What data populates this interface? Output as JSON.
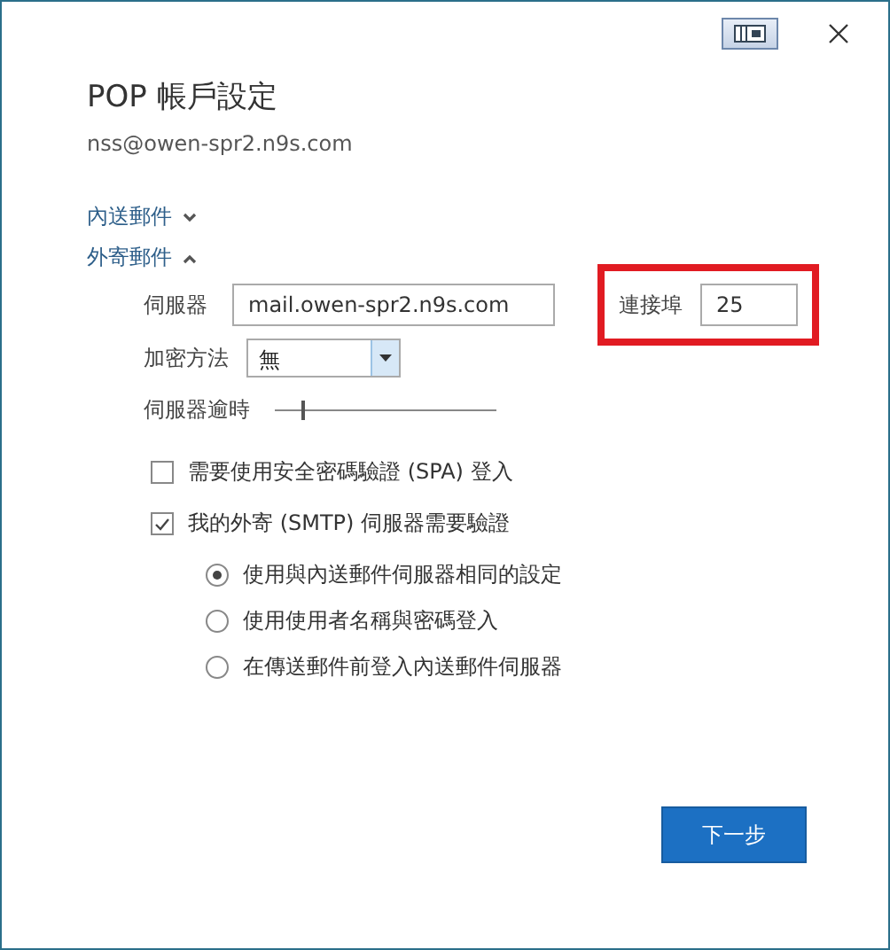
{
  "title": "POP 帳戶設定",
  "email": "nss@owen-spr2.n9s.com",
  "sections": [
    {
      "label": "內送郵件",
      "expanded": false
    },
    {
      "label": "外寄郵件",
      "expanded": true
    }
  ],
  "server": {
    "label": "伺服器",
    "value": "mail.owen-spr2.n9s.com"
  },
  "port": {
    "label": "連接埠",
    "value": "25",
    "highlighted": true
  },
  "encryption": {
    "label": "加密方法",
    "value": "無"
  },
  "timeout": {
    "label": "伺服器逾時",
    "level": 0.12
  },
  "checkboxes": [
    {
      "label": "需要使用安全密碼驗證 (SPA) 登入",
      "checked": false
    },
    {
      "label": "我的外寄 (SMTP) 伺服器需要驗證",
      "checked": true
    }
  ],
  "radios": [
    {
      "label": "使用與內送郵件伺服器相同的設定",
      "selected": true
    },
    {
      "label": "使用使用者名稱與密碼登入",
      "selected": false
    },
    {
      "label": "在傳送郵件前登入內送郵件伺服器",
      "selected": false
    }
  ],
  "next_button": "下一步"
}
